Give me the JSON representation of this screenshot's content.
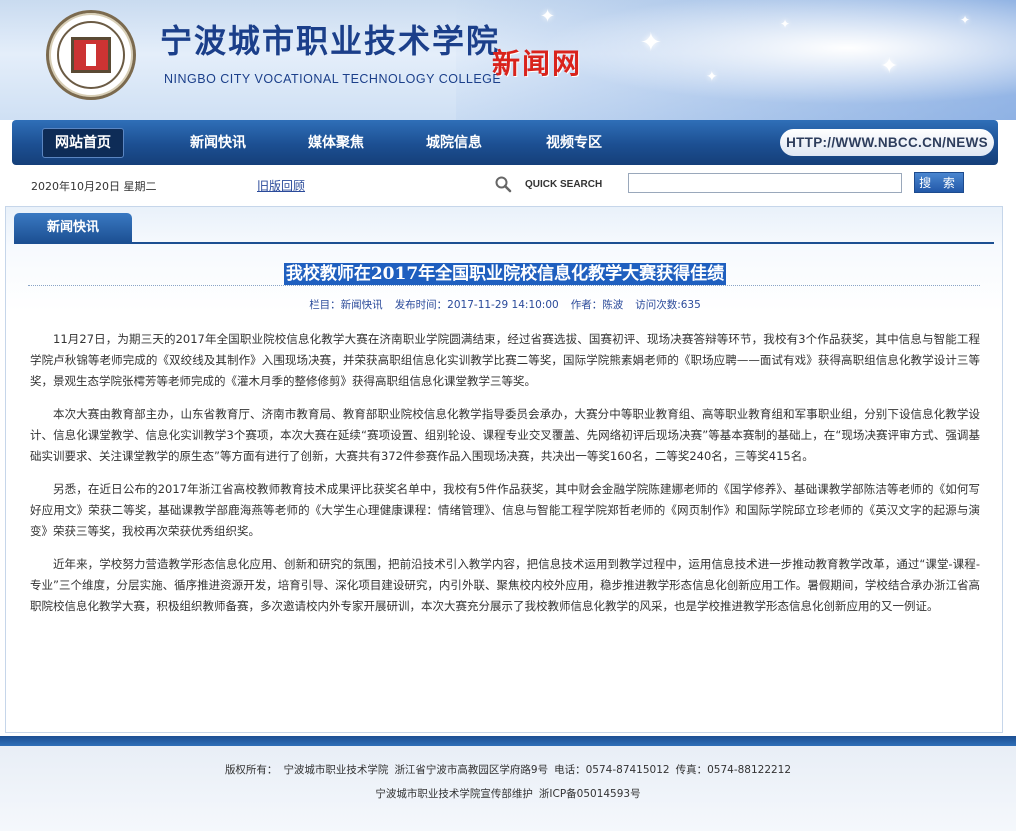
{
  "header": {
    "title_cn": "宁波城市职业技术学院",
    "title_en": "NINGBO CITY VOCATIONAL TECHNOLOGY COLLEGE",
    "site_name": "新闻网",
    "logo_icon": "college-seal-icon"
  },
  "nav": {
    "items": [
      {
        "label": "网站首页",
        "active": true
      },
      {
        "label": "新闻快讯",
        "active": false
      },
      {
        "label": "媒体聚焦",
        "active": false
      },
      {
        "label": "城院信息",
        "active": false
      },
      {
        "label": "视频专区",
        "active": false
      }
    ],
    "url": "HTTP://WWW.NBCC.CN/NEWS"
  },
  "infobar": {
    "date": "2020年10月20日 星期二",
    "old_version": "旧版回顾",
    "quick_search": "QUICK SEARCH",
    "search_value": "",
    "search_button": "搜 索"
  },
  "section": {
    "tab": "新闻快讯"
  },
  "article": {
    "title": "我校教师在2017年全国职业院校信息化教学大赛获得佳绩",
    "meta": {
      "column": "栏目：新闻快讯",
      "published": "发布时间：2017-11-29 14:10:00",
      "author": "作者：陈波",
      "views": "访问次数:635"
    },
    "paragraphs": [
      "11月27日，为期三天的2017年全国职业院校信息化教学大赛在济南职业学院圆满结束，经过省赛选拔、国赛初评、现场决赛答辩等环节，我校有3个作品获奖，其中信息与智能工程学院卢秋锦等老师完成的《双绞线及其制作》入围现场决赛，并荣获高职组信息化实训教学比赛二等奖，国际学院熊素娟老师的《职场应聘——面试有戏》获得高职组信息化教学设计三等奖，景观生态学院张樗芳等老师完成的《灌木月季的整修修剪》获得高职组信息化课堂教学三等奖。",
      "本次大赛由教育部主办，山东省教育厅、济南市教育局、教育部职业院校信息化教学指导委员会承办，大赛分中等职业教育组、高等职业教育组和军事职业组，分别下设信息化教学设计、信息化课堂教学、信息化实训教学3个赛项，本次大赛在延续“赛项设置、组别轮设、课程专业交叉覆盖、先网络初评后现场决赛”等基本赛制的基础上，在“现场决赛评审方式、强调基础实训要求、关注课堂教学的原生态”等方面有进行了创新，大赛共有372件参赛作品入围现场决赛，共决出一等奖160名，二等奖240名，三等奖415名。",
      "另悉，在近日公布的2017年浙江省高校教师教育技术成果评比获奖名单中，我校有5件作品获奖，其中财会金融学院陈建娜老师的《国学修养》、基础课教学部陈洁等老师的《如何写好应用文》荣获二等奖，基础课教学部鹿海燕等老师的《大学生心理健康课程：情绪管理》、信息与智能工程学院郑哲老师的《网页制作》和国际学院邱立珍老师的《英汉文字的起源与演变》荣获三等奖，我校再次荣获优秀组织奖。",
      "近年来，学校努力营造教学形态信息化应用、创新和研究的氛围，把前沿技术引入教学内容，把信息技术运用到教学过程中，运用信息技术进一步推动教育教学改革，通过“课堂-课程-专业”三个维度，分层实施、循序推进资源开发，培育引导、深化项目建设研究，内引外联、聚焦校内校外应用，稳步推进教学形态信息化创新应用工作。暑假期间，学校结合承办浙江省高职院校信息化教学大赛，积极组织教师备赛，多次邀请校内外专家开展研训，本次大赛充分展示了我校教师信息化教学的风采，也是学校推进教学形态信息化创新应用的又一例证。"
    ]
  },
  "footer": {
    "copyright_label": "版权所有：",
    "owner": "宁波城市职业技术学院",
    "address": "浙江省宁波市高教园区学府路9号",
    "phone": "电话：0574-87415012",
    "fax": "传真：0574-88122212",
    "maintainer": "宁波城市职业技术学院宣传部维护",
    "icp": "浙ICP备05014593号"
  }
}
